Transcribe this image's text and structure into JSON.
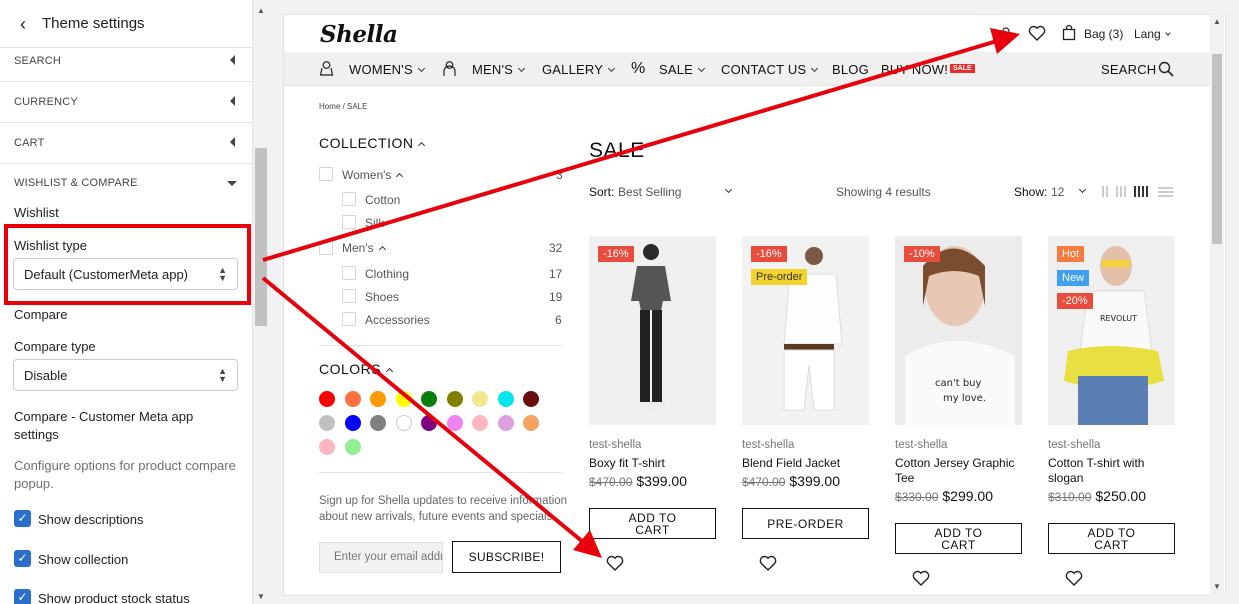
{
  "sidebar": {
    "title": "Theme settings",
    "sections": [
      {
        "label": "SEARCH"
      },
      {
        "label": "CURRENCY"
      },
      {
        "label": "CART"
      },
      {
        "label": "WISHLIST & COMPARE"
      }
    ],
    "wishlist_heading": "Wishlist",
    "wishlist_type_label": "Wishlist type",
    "wishlist_type_value": "Default (CustomerMeta app)",
    "compare_heading": "Compare",
    "compare_type_label": "Compare type",
    "compare_type_value": "Disable",
    "compare_meta_heading": "Compare - Customer Meta app settings",
    "compare_meta_help": "Configure options for product compare popup.",
    "checkboxes": [
      {
        "label": "Show descriptions",
        "checked": true
      },
      {
        "label": "Show collection",
        "checked": true
      },
      {
        "label": "Show product stock status",
        "checked": true
      }
    ]
  },
  "store": {
    "logo": "Shella",
    "bag": "Bag (3)",
    "lang": "Lang",
    "nav": [
      {
        "label": "WOMEN'S",
        "icon": "woman-icon"
      },
      {
        "label": "MEN'S",
        "icon": "man-icon"
      },
      {
        "label": "GALLERY"
      },
      {
        "label": "SALE",
        "icon": "percent-icon"
      },
      {
        "label": "CONTACT US"
      },
      {
        "label": "BLOG"
      },
      {
        "label": "BUY NOW!"
      }
    ],
    "nav_badge": "SALE",
    "search": "SEARCH",
    "breadcrumb": "Home  /  SALE",
    "collection_title": "COLLECTION",
    "filters": [
      {
        "label": "Women's",
        "count": "3"
      },
      {
        "label": "Cotton",
        "count": ""
      },
      {
        "label": "Silk",
        "count": ""
      },
      {
        "label": "Men's",
        "count": "32"
      },
      {
        "label": "Clothing",
        "count": "17"
      },
      {
        "label": "Shoes",
        "count": "19"
      },
      {
        "label": "Accessories",
        "count": "6"
      }
    ],
    "colors_title": "COLORS",
    "colors": [
      "#ff0000",
      "#ff6f40",
      "#ff9900",
      "#ffff00",
      "#0b7d0b",
      "#808000",
      "#f0e68c",
      "#00e5ee",
      "#6b0d0d",
      "#c0c0c0",
      "#0000ff",
      "#808080",
      "#ffffff",
      "#800080",
      "#ee82ee",
      "#ffb6c1",
      "#dda0dd",
      "#f4a460",
      "#ffb6c1",
      "#90ee90"
    ],
    "newsletter_text": "Sign up for Shella updates to receive information about new arrivals, future events and specials.",
    "email_placeholder": "Enter your email address",
    "subscribe": "SUBSCRIBE!",
    "page_title": "SALE",
    "sort_label": "Sort:",
    "sort_value": "Best Selling",
    "results": "Showing 4 results",
    "show_label": "Show:",
    "show_value": "12",
    "products": [
      {
        "vendor": "test-shella",
        "name": "Boxy fit T-shirt",
        "old": "$470.00",
        "price": "$399.00",
        "tags": [
          "-16%"
        ],
        "button": "ADD TO CART"
      },
      {
        "vendor": "test-shella",
        "name": "Blend Field Jacket",
        "old": "$470.00",
        "price": "$399.00",
        "tags": [
          "-16%",
          "Pre-order"
        ],
        "button": "PRE-ORDER"
      },
      {
        "vendor": "test-shella",
        "name": "Cotton Jersey Graphic Tee",
        "old": "$330.00",
        "price": "$299.00",
        "tags": [
          "-10%"
        ],
        "button": "ADD TO CART"
      },
      {
        "vendor": "test-shella",
        "name": "Cotton T-shirt with slogan",
        "old": "$310.00",
        "price": "$250.00",
        "tags": [
          "Hot",
          "New",
          "-20%"
        ],
        "button": "ADD TO CART"
      }
    ]
  },
  "colors": {
    "highlight": "#e8000b",
    "checkbox": "#2c6ecb",
    "sale_tag": "#e74c3c",
    "preorder_tag": "#f3d22b",
    "new_tag": "#3fa0f2",
    "hot_tag": "#f77b3e"
  }
}
